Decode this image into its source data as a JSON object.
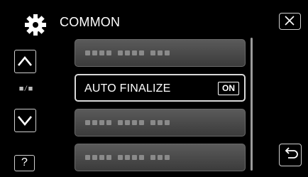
{
  "header": {
    "title": "COMMON",
    "settings_icon": "gear-icon",
    "close_icon": "close-icon"
  },
  "nav": {
    "up_icon": "chevron-up-icon",
    "down_icon": "chevron-down-icon",
    "page_indicator": "■/■",
    "help_label": "?",
    "back_icon": "return-icon"
  },
  "menu": {
    "items": [
      {
        "label": "",
        "state": "disabled"
      },
      {
        "label": "AUTO FINALIZE",
        "value": "ON",
        "state": "selected"
      },
      {
        "label": "",
        "state": "disabled"
      },
      {
        "label": "",
        "state": "disabled"
      }
    ]
  },
  "colors": {
    "background": "#000000",
    "item_inactive": "#4a4a4a",
    "border": "#d8d8d8",
    "text": "#ffffff"
  }
}
